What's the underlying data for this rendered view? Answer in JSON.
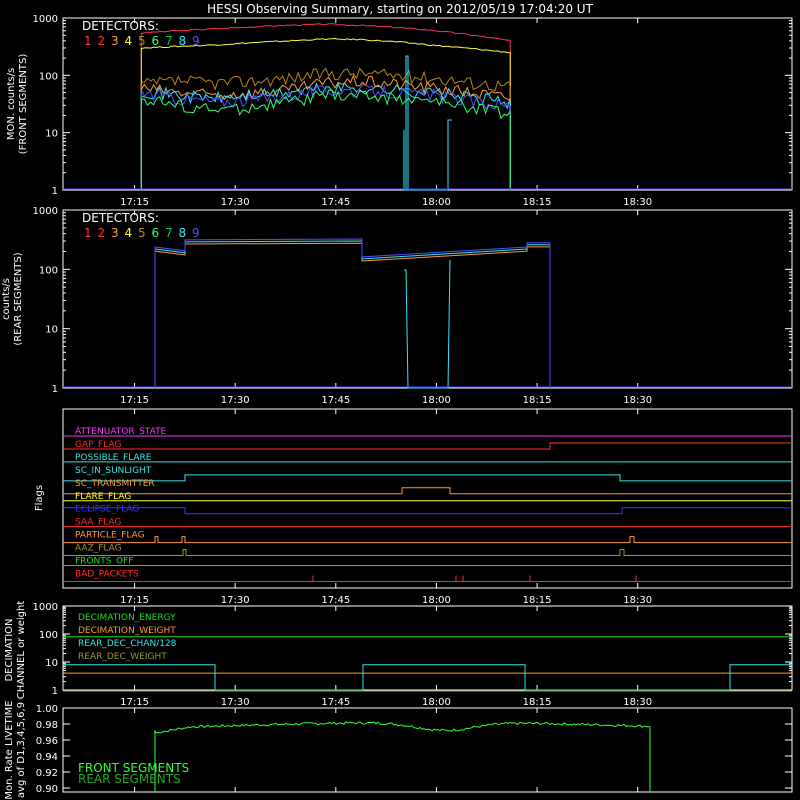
{
  "title": "HESSI Observing Summary, starting on 2012/05/19 17:04:20 UT",
  "colors": {
    "det1": "#ff3355",
    "det2": "#ff3030",
    "det3": "#ff9933",
    "det4": "#ffff33",
    "det5": "#b8860b",
    "det6": "#33ff66",
    "det7": "#00cc44",
    "det8": "#33e6ff",
    "det9": "#4f4fff",
    "magenta": "#ff33ff",
    "red": "#ff2a2a",
    "cyan": "#33e6e6",
    "orange": "#ff9933",
    "yellow": "#ffff33",
    "blue": "#3333ff",
    "green": "#22dd22",
    "olive": "#999933"
  },
  "time_axis": {
    "ticks": [
      "17:15",
      "17:30",
      "17:45",
      "18:00",
      "18:15",
      "18:30"
    ]
  },
  "chart_data": [
    {
      "type": "line",
      "panel": "front",
      "ylabel": "MON. counts/s (FRONT SEGMENTS)",
      "yscale": "log",
      "ylim": [
        1,
        1000
      ],
      "yticks": [
        "1",
        "10",
        "100",
        "1000"
      ],
      "legend_title": "DETECTORS:",
      "legend_labels": [
        "1",
        "2",
        "3",
        "4",
        "5",
        "6",
        "7",
        "8",
        "9"
      ],
      "x_range": [
        "17:04:20",
        "18:53:00"
      ],
      "data_range": [
        "17:16:00",
        "18:11:00"
      ],
      "series": [
        {
          "name": "1",
          "color_key": "det1",
          "values": [
            550,
            600,
            650,
            700,
            750,
            780,
            740,
            680,
            600,
            500,
            400
          ]
        },
        {
          "name": "4",
          "color_key": "det4",
          "values": [
            300,
            320,
            340,
            370,
            400,
            430,
            420,
            380,
            330,
            290,
            250
          ]
        },
        {
          "name": "5",
          "color_key": "det5",
          "values": [
            70,
            80,
            75,
            80,
            90,
            110,
            110,
            100,
            90,
            75,
            65
          ]
        },
        {
          "name": "3",
          "color_key": "det3",
          "values": [
            60,
            50,
            45,
            50,
            55,
            75,
            80,
            70,
            60,
            50,
            40
          ]
        },
        {
          "name": "8",
          "color_key": "det8",
          "values": [
            55,
            45,
            40,
            45,
            50,
            60,
            60,
            55,
            50,
            40,
            35
          ]
        },
        {
          "name": "9",
          "color_key": "det9",
          "values": [
            50,
            40,
            35,
            38,
            45,
            55,
            55,
            50,
            45,
            35,
            30
          ]
        },
        {
          "name": "6",
          "color_key": "det6",
          "values": [
            40,
            30,
            25,
            28,
            35,
            45,
            45,
            40,
            35,
            28,
            22
          ]
        }
      ]
    },
    {
      "type": "line",
      "panel": "rear",
      "ylabel": "counts/s (REAR SEGMENTS)",
      "yscale": "log",
      "ylim": [
        1,
        1000
      ],
      "yticks": [
        "1",
        "10",
        "100",
        "1000"
      ],
      "legend_title": "DETECTORS:",
      "legend_labels": [
        "1",
        "2",
        "3",
        "4",
        "5",
        "6",
        "7",
        "8",
        "9"
      ],
      "series": [
        {
          "name": "3",
          "color_key": "det3",
          "values": [
            200,
            280,
            290,
            300,
            150,
            220,
            180,
            250
          ]
        },
        {
          "name": "8",
          "color_key": "det8",
          "values": [
            210,
            290,
            300,
            310,
            160,
            230,
            190,
            260
          ]
        },
        {
          "name": "9",
          "color_key": "det9",
          "values": [
            200,
            280,
            290,
            300,
            150,
            220,
            180,
            250
          ]
        }
      ]
    },
    {
      "type": "flags",
      "panel": "flags",
      "ylabel": "Flags",
      "flags": [
        {
          "label": "ATTENUATOR_STATE",
          "color_key": "magenta"
        },
        {
          "label": "GAP_FLAG",
          "color_key": "red"
        },
        {
          "label": "POSSIBLE_FLARE",
          "color_key": "cyan"
        },
        {
          "label": "SC_IN_SUNLIGHT",
          "color_key": "cyan"
        },
        {
          "label": "SC_TRANSMITTER",
          "color_key": "orange"
        },
        {
          "label": "FLARE_FLAG",
          "color_key": "yellow"
        },
        {
          "label": "ECLIPSE_FLAG",
          "color_key": "blue"
        },
        {
          "label": "SAA_FLAG",
          "color_key": "red"
        },
        {
          "label": "PARTICLE_FLAG",
          "color_key": "orange"
        },
        {
          "label": "AAZ_FLAG",
          "color_key": "olive"
        },
        {
          "label": "FRONTS_OFF",
          "color_key": "green"
        },
        {
          "label": "BAD_PACKETS",
          "color_key": "red"
        }
      ]
    },
    {
      "type": "line",
      "panel": "decimation",
      "ylabel": "DECIMATION CHANNEL or weight",
      "yscale": "log",
      "ylim": [
        1,
        1000
      ],
      "yticks": [
        "1",
        "10",
        "100",
        "1000"
      ],
      "legend_labels": [
        "DECIMATION_ENERGY",
        "DECIMATION_WEIGHT",
        "REAR_DEC_CHAN/128",
        "REAR_DEC_WEIGHT"
      ],
      "legend_color_keys": [
        "green",
        "orange",
        "cyan",
        "olive"
      ]
    },
    {
      "type": "line",
      "panel": "livetime",
      "ylabel": "Mon. Rate LIVETIME avg of D1,3,4,5,6,9",
      "ylim": [
        0.895,
        1.0
      ],
      "yticks": [
        "0.90",
        "0.92",
        "0.94",
        "0.96",
        "0.98",
        "1.00"
      ],
      "legend_labels": [
        "FRONT SEGMENTS",
        "REAR SEGMENTS"
      ],
      "legend_color_keys": [
        "green",
        "green"
      ]
    }
  ]
}
